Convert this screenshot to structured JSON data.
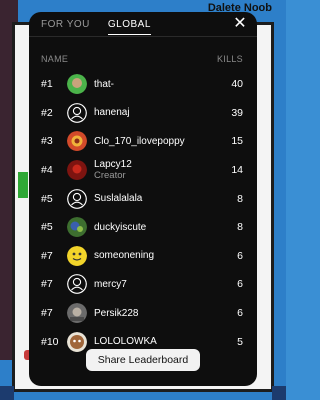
{
  "background": {
    "top_right_text": "Dalete Noob"
  },
  "tabs": [
    {
      "label": "FOR YOU",
      "active": false
    },
    {
      "label": "GLOBAL",
      "active": true
    }
  ],
  "close_icon": "close-icon",
  "columns": {
    "name": "NAME",
    "kills": "KILLS"
  },
  "rows": [
    {
      "rank": "#1",
      "name": "that-",
      "kills": "40",
      "avatar": "green-face"
    },
    {
      "rank": "#2",
      "name": "hanenaj",
      "kills": "39",
      "avatar": "default-face"
    },
    {
      "rank": "#3",
      "name": "Clo_170_ilovepoppy",
      "kills": "15",
      "avatar": "red-face"
    },
    {
      "rank": "#4",
      "name": "Lapcy12",
      "subtitle": "Creator",
      "kills": "14",
      "avatar": "red-dark-face"
    },
    {
      "rank": "#5",
      "name": "Suslalalala",
      "kills": "8",
      "avatar": "default-face"
    },
    {
      "rank": "#5",
      "name": "duckyiscute",
      "kills": "8",
      "avatar": "green-blue-face"
    },
    {
      "rank": "#7",
      "name": "someonening",
      "kills": "6",
      "avatar": "yellow-face"
    },
    {
      "rank": "#7",
      "name": "mercy7",
      "kills": "6",
      "avatar": "default-face"
    },
    {
      "rank": "#7",
      "name": "Persik228",
      "kills": "6",
      "avatar": "grey-face"
    },
    {
      "rank": "#10",
      "name": "LOLOLOWKA",
      "kills": "5",
      "avatar": "brown-face"
    }
  ],
  "share_label": "Share Leaderboard"
}
